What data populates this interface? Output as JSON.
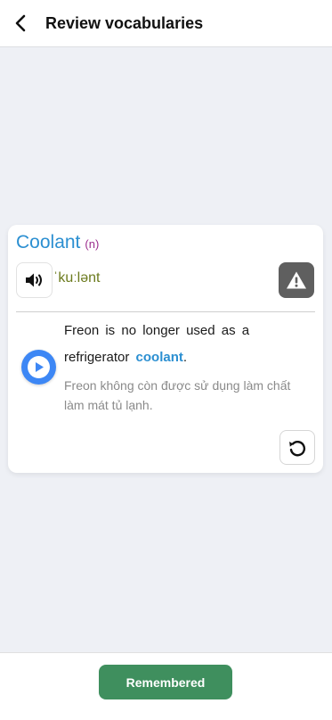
{
  "header": {
    "title": "Review vocabularies",
    "back_icon": "chevron-left-icon"
  },
  "card": {
    "word": "Coolant",
    "part_of_speech": "(n)",
    "phonetic": "ˈkuːlənt",
    "example": {
      "before": "Freon is no longer used as a refrigerator ",
      "highlight": "coolant",
      "after": "."
    },
    "translation": "Freon không còn được sử dụng làm chất làm mát tủ lạnh."
  },
  "footer": {
    "remembered_label": "Remembered"
  },
  "colors": {
    "word": "#2b8fd1",
    "part_of_speech": "#9b2d8e",
    "phonetic": "#6b7a1d",
    "play_button": "#3d87f5",
    "remembered_button": "#3f8f5e",
    "report_button": "#5f5f5f"
  }
}
